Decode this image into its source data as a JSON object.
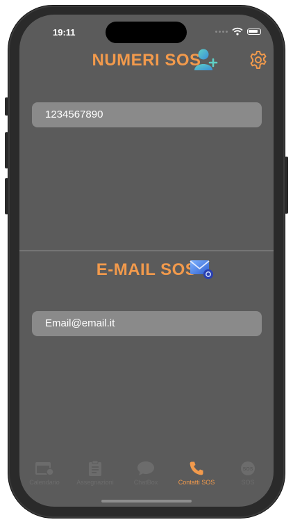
{
  "status": {
    "time": "19:11"
  },
  "header": {
    "title": "NUMERI SOS",
    "add_contact_icon": "person-add-icon",
    "settings_icon": "gear-icon"
  },
  "numbers": {
    "items": [
      "1234567890"
    ]
  },
  "email_section": {
    "title": "E-MAIL SOS",
    "icon": "envelope-icon"
  },
  "emails": {
    "items": [
      "Email@email.it"
    ]
  },
  "tabbar": {
    "tabs": [
      {
        "label": "Calendario",
        "icon": "calendar-icon"
      },
      {
        "label": "Assegnazioni",
        "icon": "clipboard-icon"
      },
      {
        "label": "ChatBox",
        "icon": "chat-bubble-icon"
      },
      {
        "label": "Contatti SOS",
        "icon": "phone-icon",
        "active": true
      },
      {
        "label": "SOS",
        "icon": "sos-icon"
      }
    ]
  },
  "colors": {
    "accent": "#f29a4c",
    "background": "#5b5b5b",
    "field": "#8a8a8a",
    "inactive_tab": "#6c6c6c"
  }
}
